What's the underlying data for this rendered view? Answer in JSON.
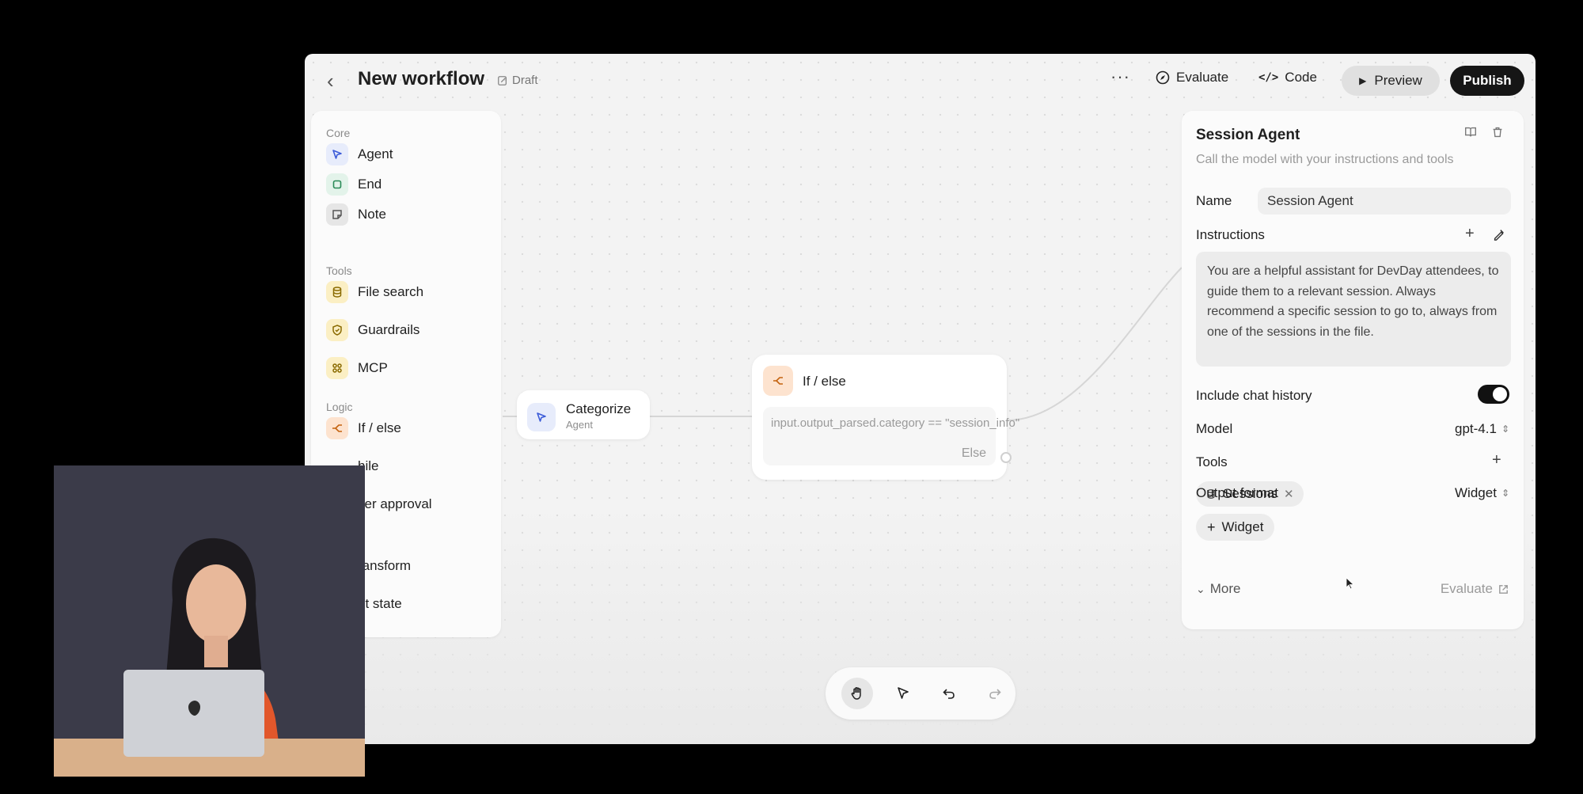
{
  "header": {
    "title": "New workflow",
    "draft_label": "Draft",
    "more_label": "···",
    "evaluate_label": "Evaluate",
    "code_label": "Code",
    "preview_label": "Preview",
    "publish_label": "Publish"
  },
  "sidebar": {
    "sections": [
      {
        "label": "Core",
        "items": [
          {
            "label": "Agent",
            "icon": "agent-icon"
          },
          {
            "label": "End",
            "icon": "end-icon"
          },
          {
            "label": "Note",
            "icon": "note-icon"
          }
        ]
      },
      {
        "label": "Tools",
        "items": [
          {
            "label": "File search",
            "icon": "database-icon"
          },
          {
            "label": "Guardrails",
            "icon": "shield-icon"
          },
          {
            "label": "MCP",
            "icon": "mcp-icon"
          }
        ]
      },
      {
        "label": "Logic",
        "items": [
          {
            "label": "If / else",
            "icon": "branch-icon"
          },
          {
            "label": "hile",
            "icon": "loop-icon"
          },
          {
            "label": "ser approval",
            "icon": "approval-icon"
          }
        ]
      },
      {
        "label": "",
        "items": [
          {
            "label": "ransform",
            "icon": "transform-icon"
          },
          {
            "label": "et state",
            "icon": "state-icon"
          }
        ]
      }
    ]
  },
  "canvas": {
    "categorize_node": {
      "name": "Categorize",
      "type": "Agent"
    },
    "ifelse_node": {
      "name": "If / else",
      "condition": "input.output_parsed.category == \"session_info\"",
      "else_label": "Else"
    }
  },
  "panel": {
    "title": "Session Agent",
    "description": "Call the model with your instructions and tools",
    "name_label": "Name",
    "name_value": "Session Agent",
    "instructions_label": "Instructions",
    "instructions_text": "You are a helpful assistant for DevDay attendees, to guide them to a relevant session. Always recommend a specific session to go to, always from one of the sessions in the file.",
    "chat_history_label": "Include chat history",
    "chat_history_on": true,
    "model_label": "Model",
    "model_value": "gpt-4.1",
    "tools_label": "Tools",
    "tool_chip": "Sessions",
    "output_format_label": "Output format",
    "output_format_value": "Widget",
    "widget_button": "Widget",
    "more_label": "More",
    "evaluate_link": "Evaluate"
  },
  "colors": {
    "publish_bg": "#161616",
    "toggle_on": "#111111",
    "agent_accent": "#3b5bd8",
    "tool_accent": "#8a6a00",
    "logic_accent": "#c4620e"
  }
}
